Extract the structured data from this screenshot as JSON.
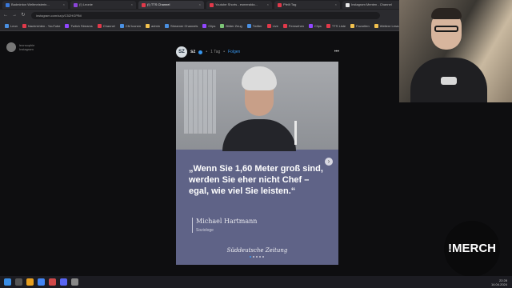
{
  "browser": {
    "tabs": [
      {
        "label": "Badminton Weltmeisterin...",
        "color": "#3a78d8"
      },
      {
        "label": "(!) Leonie",
        "color": "#8a44d8"
      },
      {
        "label": "(!) TTS Channel",
        "color": "#e0394a",
        "active": true
      },
      {
        "label": "Youtube Shorts - esmeralda...",
        "color": "#e0394a"
      },
      {
        "label": "Pfeilt Tag",
        "color": "#e0394a"
      },
      {
        "label": "Instagram Menten - Channel",
        "color": "#e8e8e8"
      }
    ],
    "url": "instagram.com/sz/p/C5ZHGPBtl",
    "bookmarks": [
      {
        "label": "Leon",
        "color": "#4a90e2"
      },
      {
        "label": "Nachrichten - YouTube",
        "color": "#e0394a"
      },
      {
        "label": "Twitch Streams",
        "color": "#9146ff"
      },
      {
        "label": "Channel",
        "color": "#e0394a"
      },
      {
        "label": "CM Iconen",
        "color": "#4a90e2"
      },
      {
        "label": "admin",
        "color": "#f2c14e"
      },
      {
        "label": "Streamer Channels",
        "color": "#4a90e2"
      },
      {
        "label": "Clips",
        "color": "#9146ff"
      },
      {
        "label": "Bilder Zeug",
        "color": "#7cc576"
      },
      {
        "label": "Twitter",
        "color": "#4a90e2"
      },
      {
        "label": "Live",
        "color": "#e0394a"
      },
      {
        "label": "Fernsehen",
        "color": "#e0394a"
      },
      {
        "label": "Clips",
        "color": "#9146ff"
      },
      {
        "label": "TTS Liste",
        "color": "#e0394a"
      },
      {
        "label": "Favoriten",
        "color": "#f2c14e"
      },
      {
        "label": "Weitere Lesezeichen",
        "color": "#f2c14e"
      }
    ]
  },
  "sidebar_user": {
    "name": "leonsophie",
    "sub": "Instagram"
  },
  "post": {
    "account": "sz",
    "logo_text": "SZ",
    "time": "1 Tag",
    "separator": "•",
    "follow": "Folgen",
    "more": "•••",
    "quote": "„Wenn Sie 1,60 Meter groß sind, werden Sie eher nicht Chef – egal, wie viel Sie leisten.“",
    "author": "Michael Hartmann",
    "author_role": "Soziologe",
    "publisher": "Süddeutsche Zeitung",
    "slide_count": 5,
    "active_slide": 1
  },
  "overlay": {
    "merch_label": "!MERCH"
  },
  "taskbar": {
    "time": "22:28",
    "date": "14.04.2024"
  }
}
